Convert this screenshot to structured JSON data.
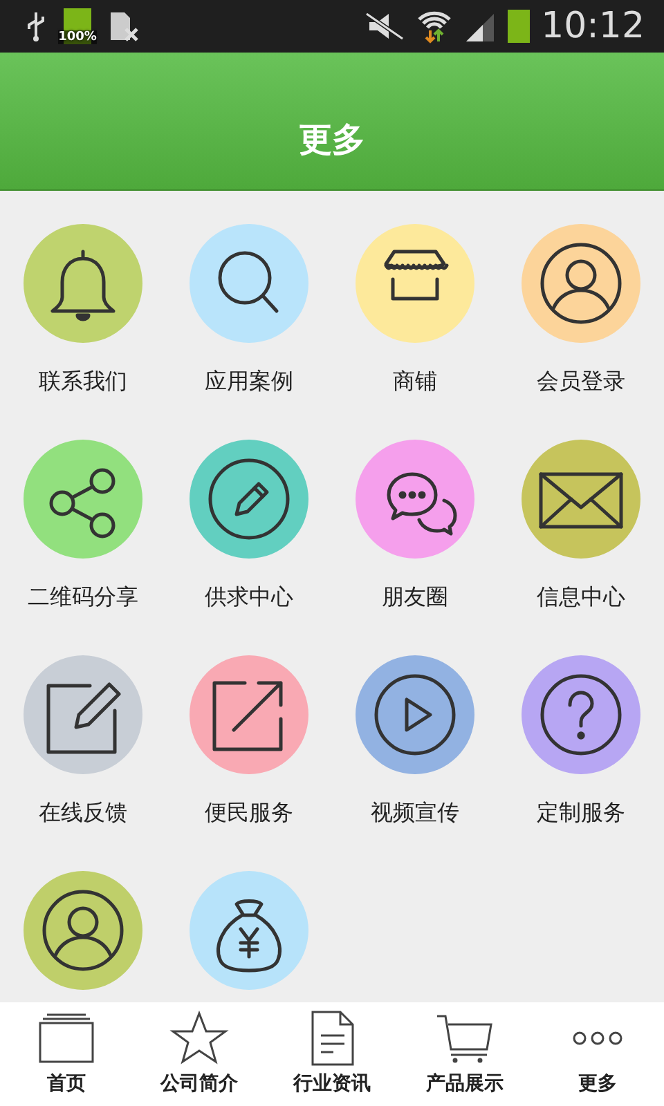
{
  "status_bar": {
    "battery_label": "100%",
    "time": "10:12"
  },
  "header": {
    "title": "更多"
  },
  "items": [
    {
      "label": "联系我们",
      "kind": "bell",
      "color": "#bfd36e"
    },
    {
      "label": "应用案例",
      "kind": "search",
      "color": "#b9e4fb"
    },
    {
      "label": "商铺",
      "kind": "shop",
      "color": "#fde99b"
    },
    {
      "label": "会员登录",
      "kind": "user",
      "color": "#fcd49a"
    },
    {
      "label": "二维码分享",
      "kind": "share",
      "color": "#92e07e"
    },
    {
      "label": "供求中心",
      "kind": "pencil",
      "color": "#62cfc0"
    },
    {
      "label": "朋友圈",
      "kind": "chat",
      "color": "#f59fec"
    },
    {
      "label": "信息中心",
      "kind": "envelope",
      "color": "#c6c45c"
    },
    {
      "label": "在线反馈",
      "kind": "edit",
      "color": "#c8ced6"
    },
    {
      "label": "便民服务",
      "kind": "external",
      "color": "#f9a9b3"
    },
    {
      "label": "视频宣传",
      "kind": "play",
      "color": "#92b2e2"
    },
    {
      "label": "定制服务",
      "kind": "question",
      "color": "#b7a6f3"
    },
    {
      "kind": "user",
      "color": "#bfcf6a"
    },
    {
      "kind": "money",
      "color": "#b7e3fa"
    }
  ],
  "nav": [
    {
      "label": "首页",
      "kind": "home"
    },
    {
      "label": "公司简介",
      "kind": "star"
    },
    {
      "label": "行业资讯",
      "kind": "document"
    },
    {
      "label": "产品展示",
      "kind": "cart"
    },
    {
      "label": "更多",
      "kind": "more"
    }
  ]
}
